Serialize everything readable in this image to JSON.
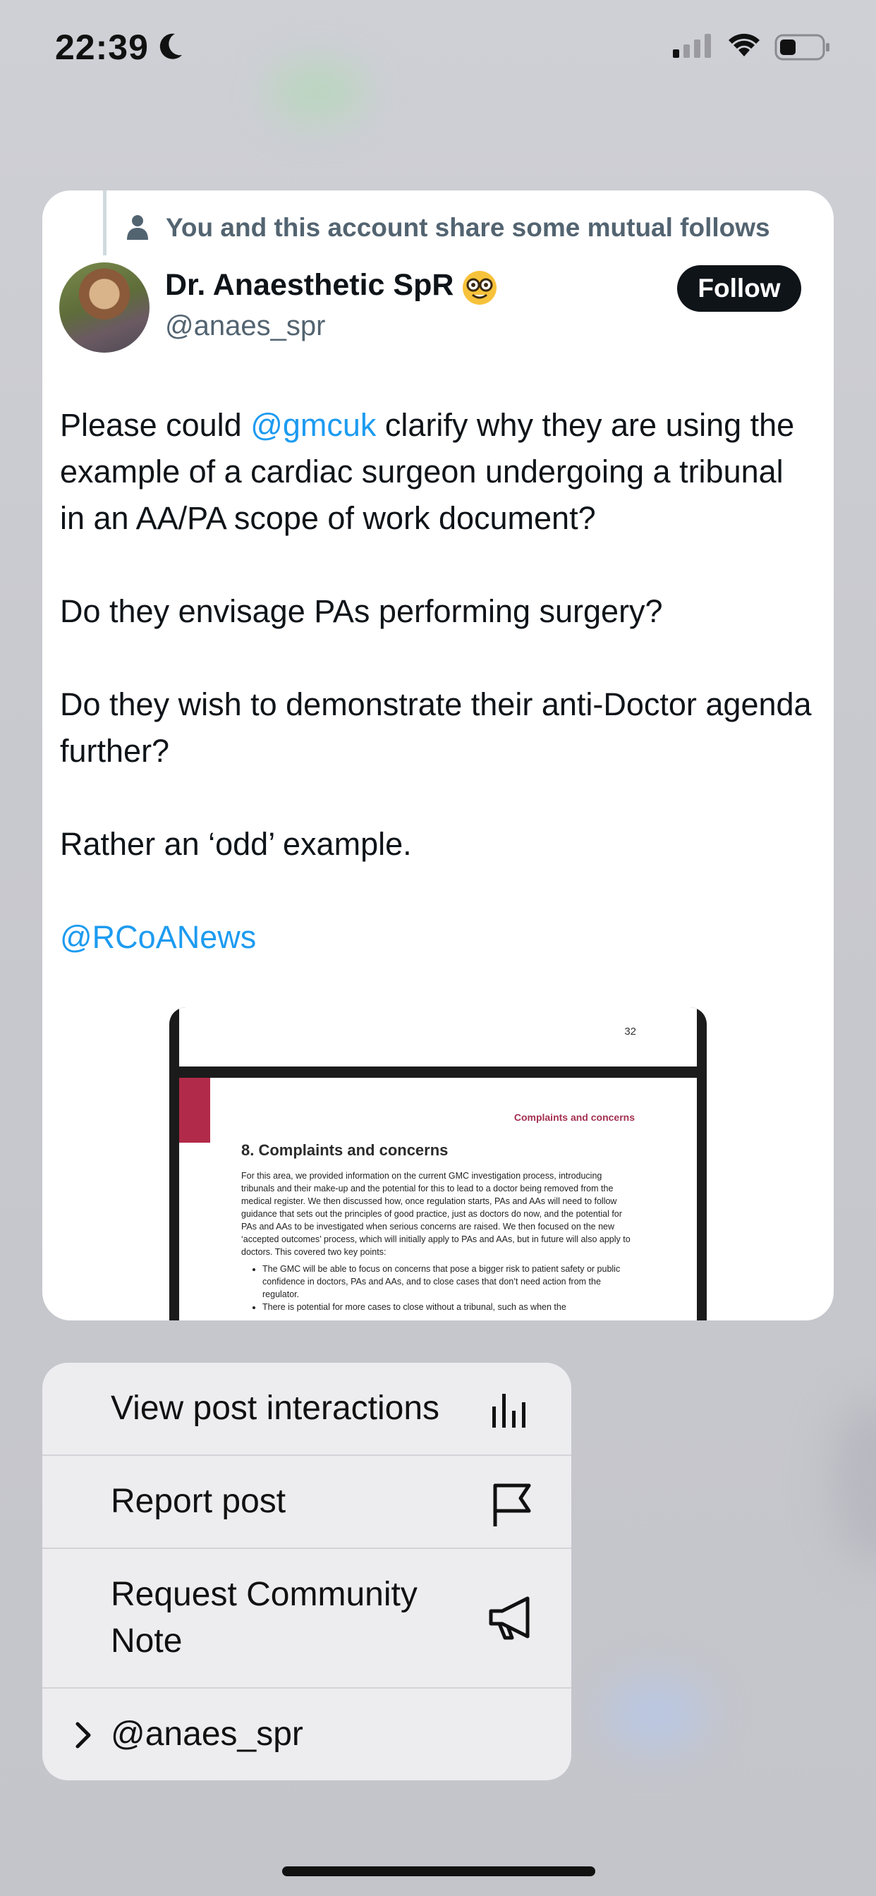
{
  "status_bar": {
    "time": "22:39"
  },
  "post": {
    "social_context": "You and this account share some mutual follows",
    "author": {
      "name": "Dr. Anaesthetic SpR",
      "emoji": "nerd-face",
      "handle": "@anaes_spr"
    },
    "follow_label": "Follow",
    "text": {
      "p1_before": "Please could ",
      "p1_mention": "@gmcuk",
      "p1_after": " clarify why they are using the example of a cardiac surgeon undergoing a tribunal in an AA/PA scope of work document?",
      "p2": "Do they envisage PAs performing surgery?",
      "p3": "Do they wish to demonstrate their anti-Doctor agenda further?",
      "p4": "Rather an ‘odd’ example.",
      "p5_mention": "@RCoANews"
    },
    "attachment": {
      "page_number": "32",
      "section_header": "Complaints and concerns",
      "heading": "8. Complaints and concerns",
      "body": "For this area, we provided information on the current GMC investigation process, introducing tribunals and their make-up and the potential for this to lead to a doctor being removed from the medical register. We then discussed how, once regulation starts, PAs and AAs will need to follow guidance that sets out the principles of good practice, just as doctors do now, and the potential for PAs and AAs to be investigated when serious concerns are raised. We then focused on the new ‘accepted outcomes’ process, which will initially apply to PAs and AAs, but in future will also apply to doctors. This covered two key points:",
      "bullet1": "The GMC will be able to focus on concerns that pose a bigger risk to patient safety or public confidence in doctors, PAs and AAs, and to close cases that don’t need action from the regulator.",
      "bullet2": "There is potential for more cases to close without a tribunal, such as when the"
    }
  },
  "menu": {
    "items": [
      {
        "label": "View post interactions",
        "icon": "bar-chart-icon"
      },
      {
        "label": "Report post",
        "icon": "flag-icon"
      },
      {
        "label": "Request Community Note",
        "icon": "megaphone-icon"
      },
      {
        "label": "@anaes_spr",
        "icon": "chevron-right-icon"
      }
    ]
  },
  "colors": {
    "accent": "#1d9bf0",
    "text_primary": "#0f1419",
    "text_secondary": "#536471",
    "doc_red": "#b22a49"
  }
}
